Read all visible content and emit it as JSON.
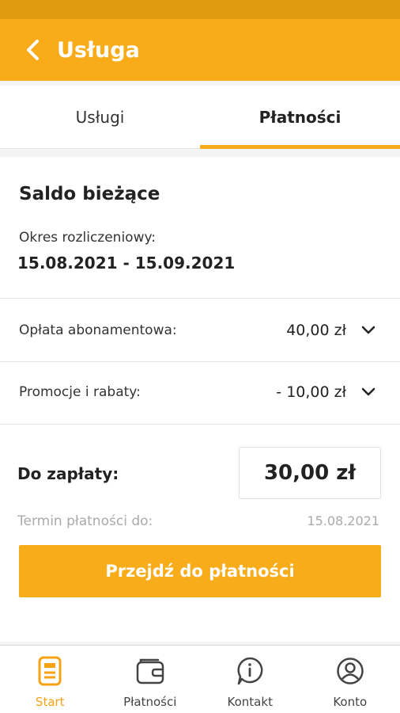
{
  "app_bar": {
    "title": "Usługa"
  },
  "tabs": [
    {
      "label": "Usługi"
    },
    {
      "label": "Płatności"
    }
  ],
  "balance": {
    "title": "Saldo bieżące",
    "period_label": "Okres rozliczeniowy:",
    "period_value": "15.08.2021 - 15.09.2021"
  },
  "rows": [
    {
      "label": "Opłata abonamentowa:",
      "value": "40,00 zł"
    },
    {
      "label": "Promocje i rabaty:",
      "value": "- 10,00 zł"
    }
  ],
  "payment": {
    "label": "Do zapłaty:",
    "amount": "30,00 zł",
    "due_label": "Termin płatności do:",
    "due_value": "15.08.2021",
    "button": "Przejdź do płatności"
  },
  "bottom_nav": [
    {
      "label": "Start",
      "icon": "document-icon",
      "active": true
    },
    {
      "label": "Płatności",
      "icon": "wallet-icon",
      "active": false
    },
    {
      "label": "Kontakt",
      "icon": "info-icon",
      "active": false
    },
    {
      "label": "Konto",
      "icon": "user-icon",
      "active": false
    }
  ],
  "colors": {
    "accent": "#f9ac1a",
    "status_bar": "#e09a10"
  }
}
